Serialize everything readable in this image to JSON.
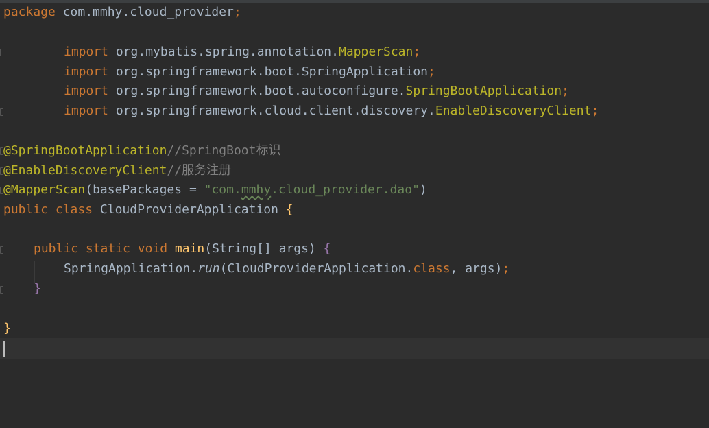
{
  "code": {
    "l1": {
      "kw": "package",
      "pkg": " com.mmhy.cloud_provider",
      "semi": ";"
    },
    "imports": [
      {
        "kw": "import",
        "path": " org.mybatis.spring.annotation.",
        "cls": "MapperScan",
        "semi": ";"
      },
      {
        "kw": "import",
        "path": " org.springframework.boot.SpringApplication",
        "semi": ";"
      },
      {
        "kw": "import",
        "path": " org.springframework.boot.autoconfigure.",
        "cls": "SpringBootApplication",
        "semi": ";"
      },
      {
        "kw": "import",
        "path": " org.springframework.cloud.client.discovery.",
        "cls": "EnableDiscoveryClient",
        "semi": ";"
      }
    ],
    "ann1": {
      "name": "@SpringBootApplication",
      "comment": "//SpringBoot标识"
    },
    "ann2": {
      "name": "@EnableDiscoveryClient",
      "comment": "//服务注册"
    },
    "ann3": {
      "name": "@MapperScan",
      "open": "(",
      "param": "basePackages",
      "eq": " = ",
      "str_a": "\"com.",
      "str_b": "mmhy",
      "str_c": ".cloud_provider.dao\"",
      "close": ")"
    },
    "cls_decl": {
      "kw1": "public",
      "kw2": " class",
      "name": " CloudProviderApplication",
      "brace": " {"
    },
    "main_decl": {
      "kw1": "public",
      "kw2": " static",
      "kw3": " void",
      "name": " main",
      "params": "(String[] args)",
      "brace": " {"
    },
    "body": {
      "target": "SpringApplication.",
      "method": "run",
      "open": "(CloudProviderApplication.",
      "kw": "class",
      "rest": ", args)",
      "semi": ";"
    },
    "close_method": "}",
    "close_class": "}"
  },
  "colors": {
    "background": "#2b2b2b",
    "keyword": "#cc7832",
    "annotation": "#bbb529",
    "string": "#6a8759",
    "comment": "#808080",
    "method": "#ffc66d",
    "text": "#a9b7c6"
  }
}
